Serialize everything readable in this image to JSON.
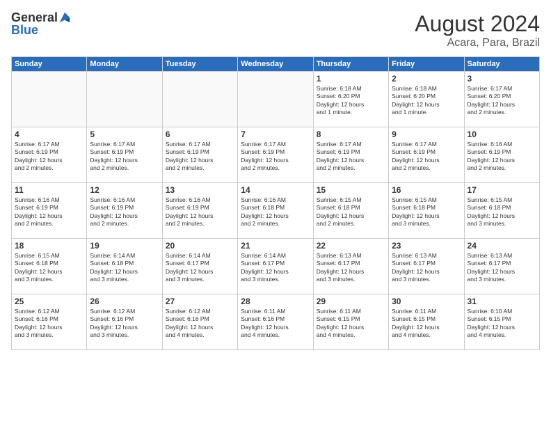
{
  "header": {
    "logo_general": "General",
    "logo_blue": "Blue",
    "month_year": "August 2024",
    "location": "Acara, Para, Brazil"
  },
  "days_of_week": [
    "Sunday",
    "Monday",
    "Tuesday",
    "Wednesday",
    "Thursday",
    "Friday",
    "Saturday"
  ],
  "weeks": [
    [
      {
        "day": "",
        "info": ""
      },
      {
        "day": "",
        "info": ""
      },
      {
        "day": "",
        "info": ""
      },
      {
        "day": "",
        "info": ""
      },
      {
        "day": "1",
        "info": "Sunrise: 6:18 AM\nSunset: 6:20 PM\nDaylight: 12 hours\nand 1 minute."
      },
      {
        "day": "2",
        "info": "Sunrise: 6:18 AM\nSunset: 6:20 PM\nDaylight: 12 hours\nand 1 minute."
      },
      {
        "day": "3",
        "info": "Sunrise: 6:17 AM\nSunset: 6:20 PM\nDaylight: 12 hours\nand 2 minutes."
      }
    ],
    [
      {
        "day": "4",
        "info": "Sunrise: 6:17 AM\nSunset: 6:19 PM\nDaylight: 12 hours\nand 2 minutes."
      },
      {
        "day": "5",
        "info": "Sunrise: 6:17 AM\nSunset: 6:19 PM\nDaylight: 12 hours\nand 2 minutes."
      },
      {
        "day": "6",
        "info": "Sunrise: 6:17 AM\nSunset: 6:19 PM\nDaylight: 12 hours\nand 2 minutes."
      },
      {
        "day": "7",
        "info": "Sunrise: 6:17 AM\nSunset: 6:19 PM\nDaylight: 12 hours\nand 2 minutes."
      },
      {
        "day": "8",
        "info": "Sunrise: 6:17 AM\nSunset: 6:19 PM\nDaylight: 12 hours\nand 2 minutes."
      },
      {
        "day": "9",
        "info": "Sunrise: 6:17 AM\nSunset: 6:19 PM\nDaylight: 12 hours\nand 2 minutes."
      },
      {
        "day": "10",
        "info": "Sunrise: 6:16 AM\nSunset: 6:19 PM\nDaylight: 12 hours\nand 2 minutes."
      }
    ],
    [
      {
        "day": "11",
        "info": "Sunrise: 6:16 AM\nSunset: 6:19 PM\nDaylight: 12 hours\nand 2 minutes."
      },
      {
        "day": "12",
        "info": "Sunrise: 6:16 AM\nSunset: 6:19 PM\nDaylight: 12 hours\nand 2 minutes."
      },
      {
        "day": "13",
        "info": "Sunrise: 6:16 AM\nSunset: 6:19 PM\nDaylight: 12 hours\nand 2 minutes."
      },
      {
        "day": "14",
        "info": "Sunrise: 6:16 AM\nSunset: 6:18 PM\nDaylight: 12 hours\nand 2 minutes."
      },
      {
        "day": "15",
        "info": "Sunrise: 6:15 AM\nSunset: 6:18 PM\nDaylight: 12 hours\nand 2 minutes."
      },
      {
        "day": "16",
        "info": "Sunrise: 6:15 AM\nSunset: 6:18 PM\nDaylight: 12 hours\nand 3 minutes."
      },
      {
        "day": "17",
        "info": "Sunrise: 6:15 AM\nSunset: 6:18 PM\nDaylight: 12 hours\nand 3 minutes."
      }
    ],
    [
      {
        "day": "18",
        "info": "Sunrise: 6:15 AM\nSunset: 6:18 PM\nDaylight: 12 hours\nand 3 minutes."
      },
      {
        "day": "19",
        "info": "Sunrise: 6:14 AM\nSunset: 6:18 PM\nDaylight: 12 hours\nand 3 minutes."
      },
      {
        "day": "20",
        "info": "Sunrise: 6:14 AM\nSunset: 6:17 PM\nDaylight: 12 hours\nand 3 minutes."
      },
      {
        "day": "21",
        "info": "Sunrise: 6:14 AM\nSunset: 6:17 PM\nDaylight: 12 hours\nand 3 minutes."
      },
      {
        "day": "22",
        "info": "Sunrise: 6:13 AM\nSunset: 6:17 PM\nDaylight: 12 hours\nand 3 minutes."
      },
      {
        "day": "23",
        "info": "Sunrise: 6:13 AM\nSunset: 6:17 PM\nDaylight: 12 hours\nand 3 minutes."
      },
      {
        "day": "24",
        "info": "Sunrise: 6:13 AM\nSunset: 6:17 PM\nDaylight: 12 hours\nand 3 minutes."
      }
    ],
    [
      {
        "day": "25",
        "info": "Sunrise: 6:12 AM\nSunset: 6:16 PM\nDaylight: 12 hours\nand 3 minutes."
      },
      {
        "day": "26",
        "info": "Sunrise: 6:12 AM\nSunset: 6:16 PM\nDaylight: 12 hours\nand 3 minutes."
      },
      {
        "day": "27",
        "info": "Sunrise: 6:12 AM\nSunset: 6:16 PM\nDaylight: 12 hours\nand 4 minutes."
      },
      {
        "day": "28",
        "info": "Sunrise: 6:11 AM\nSunset: 6:16 PM\nDaylight: 12 hours\nand 4 minutes."
      },
      {
        "day": "29",
        "info": "Sunrise: 6:11 AM\nSunset: 6:15 PM\nDaylight: 12 hours\nand 4 minutes."
      },
      {
        "day": "30",
        "info": "Sunrise: 6:11 AM\nSunset: 6:15 PM\nDaylight: 12 hours\nand 4 minutes."
      },
      {
        "day": "31",
        "info": "Sunrise: 6:10 AM\nSunset: 6:15 PM\nDaylight: 12 hours\nand 4 minutes."
      }
    ]
  ]
}
